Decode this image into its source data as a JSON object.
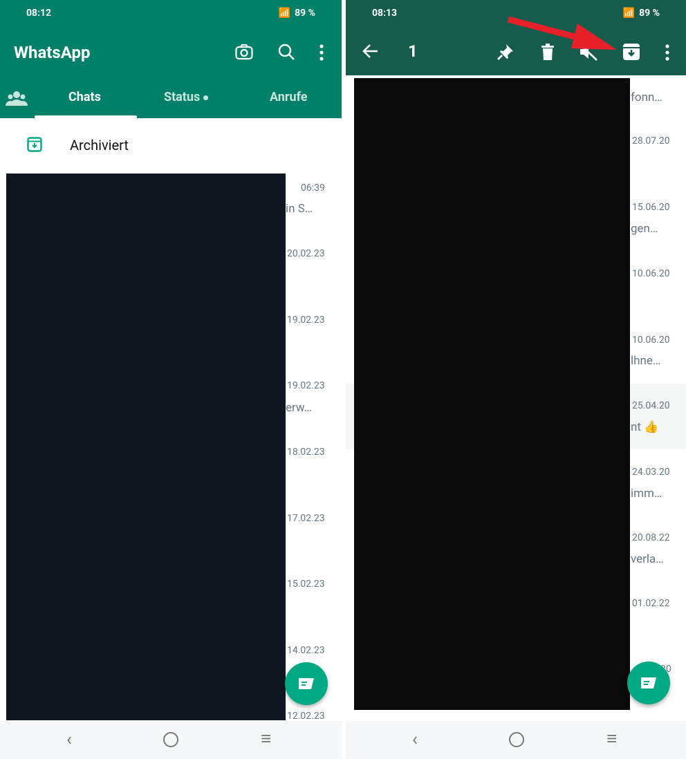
{
  "left": {
    "status": {
      "time": "08:12",
      "battery": "89 %"
    },
    "title": "WhatsApp",
    "tabs": [
      {
        "label": "Chats",
        "active": true
      },
      {
        "label": "Status",
        "dot": true
      },
      {
        "label": "Anrufe"
      }
    ],
    "archived_label": "Archiviert",
    "dates": [
      "06:39",
      "20.02.23",
      "19.02.23",
      "19.02.23",
      "18.02.23",
      "17.02.23",
      "15.02.23",
      "14.02.23",
      "12.02.23"
    ],
    "snippets": [
      "in S…",
      "erw…"
    ]
  },
  "right": {
    "status": {
      "time": "08:13",
      "battery": "89 %"
    },
    "selected_count": "1",
    "dates": [
      "28.07.20",
      "15.06.20",
      "10.06.20",
      "10.06.20",
      "25.04.20",
      "24.03.20",
      "20.08.22",
      "01.02.22",
      "20"
    ],
    "snippets": [
      "fonn…",
      "gen…",
      "lhne…",
      "nt 👍",
      "imm…",
      "verla…"
    ]
  },
  "colors": {
    "header_left": "#008069",
    "header_right": "#165c4d",
    "accent": "#00a884",
    "annotation_arrow": "#e8202a"
  },
  "icons": [
    "camera-icon",
    "search-icon",
    "more-vert-icon",
    "community-icon",
    "archive-icon",
    "back-arrow-icon",
    "pin-icon",
    "delete-icon",
    "mute-icon",
    "new-chat-icon"
  ]
}
